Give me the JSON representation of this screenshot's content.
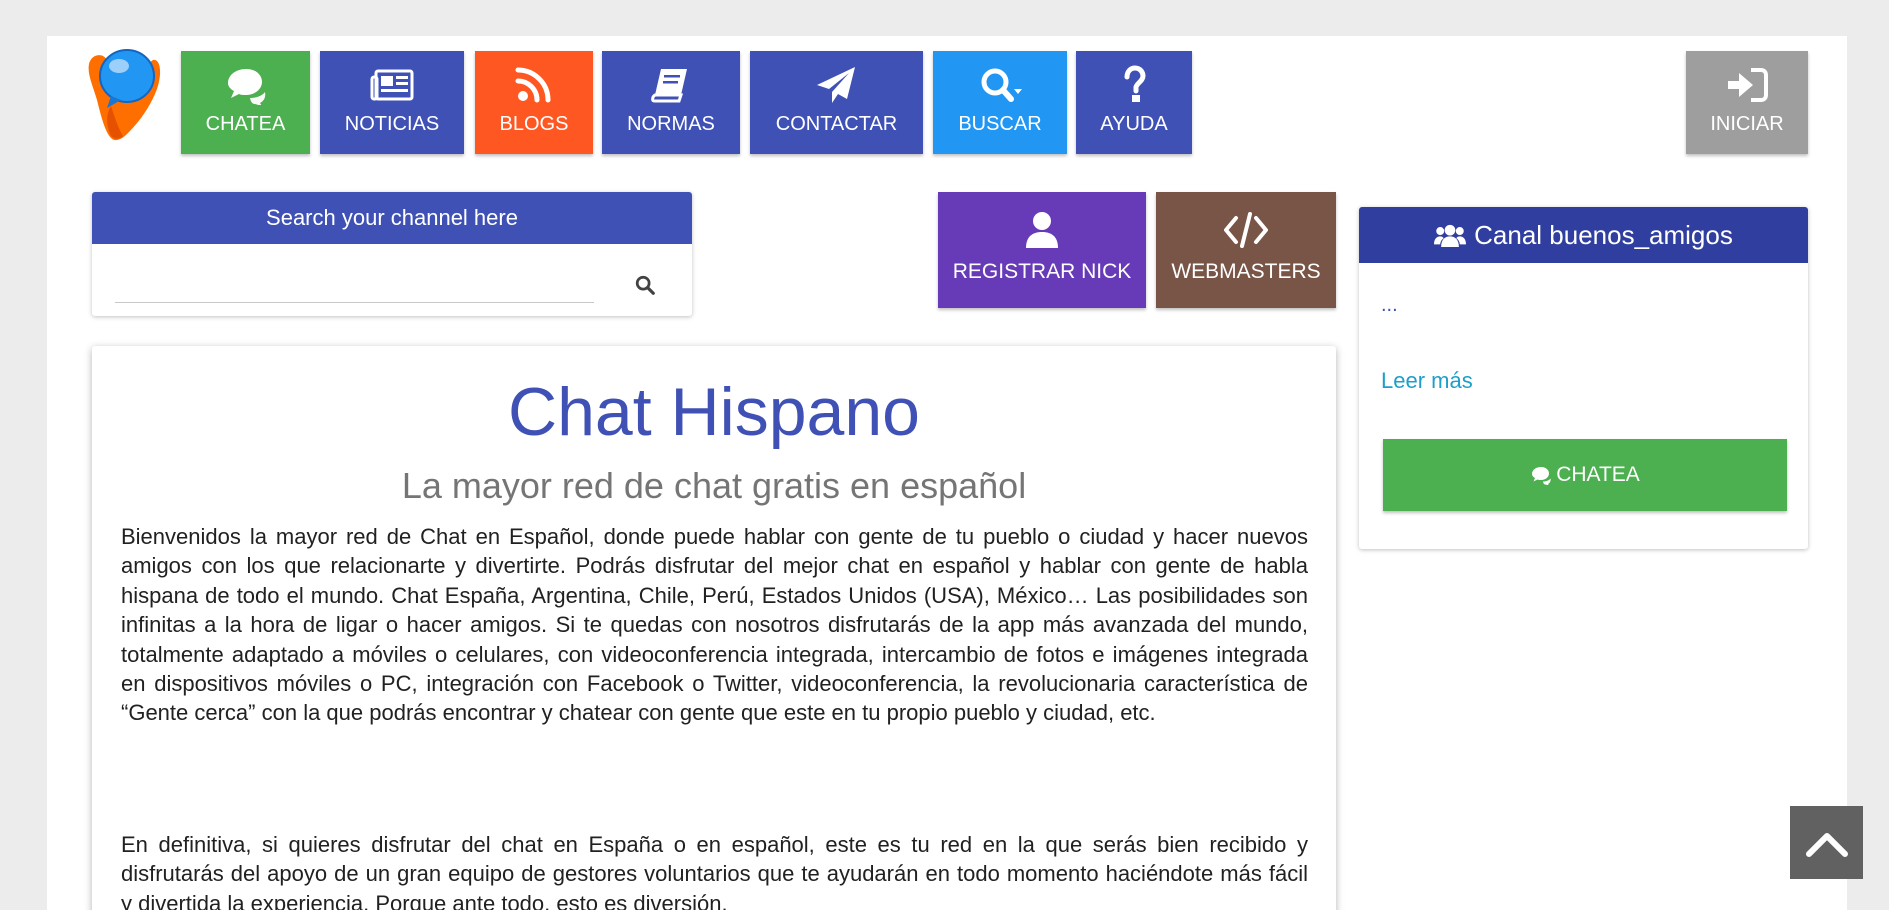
{
  "nav": {
    "items": [
      {
        "label": "CHATEA",
        "icon": "comments-icon",
        "color": "#4caf50"
      },
      {
        "label": "NOTICIAS",
        "icon": "newspaper-icon",
        "color": "#3f51b5"
      },
      {
        "label": "BLOGS",
        "icon": "rss-icon",
        "color": "#ff5722"
      },
      {
        "label": "NORMAS",
        "icon": "book-icon",
        "color": "#3f51b5"
      },
      {
        "label": "CONTACTAR",
        "icon": "paper-plane-icon",
        "color": "#3f51b5"
      },
      {
        "label": "BUSCAR",
        "icon": "search-icon",
        "color": "#2196f3"
      },
      {
        "label": "AYUDA",
        "icon": "question-icon",
        "color": "#3f51b5"
      }
    ],
    "login": {
      "label": "INICIAR",
      "icon": "sign-in-icon",
      "color": "#9e9e9e"
    }
  },
  "search": {
    "header": "Search your channel here",
    "value": "",
    "placeholder": ""
  },
  "actions": [
    {
      "label": "REGISTRAR NICK",
      "icon": "user-icon",
      "color": "#673ab7"
    },
    {
      "label": "WEBMASTERS",
      "icon": "code-icon",
      "color": "#795548"
    }
  ],
  "main": {
    "title": "Chat Hispano",
    "subtitle": "La mayor red de chat gratis en español",
    "paragraphs": [
      "Bienvenidos la mayor red de Chat en Español, donde puede hablar con gente de tu pueblo o ciudad y hacer nuevos amigos con los que relacionarte y divertirte. Podrás disfrutar del mejor chat en español y hablar con gente de habla hispana de todo el mundo. Chat España, Argentina, Chile, Perú, Estados Unidos (USA), México… Las posibilidades son infinitas a la hora de ligar o hacer amigos. Si te quedas con nosotros disfrutarás de la app más avanzada del mundo, totalmente adaptado a móviles o celulares, con videoconferencia integrada, intercambio de fotos e imágenes integrada en dispositivos móviles o PC, integración con Facebook o Twitter, videoconferencia, la revolucionaria característica de “Gente cerca” con la que podrás encontrar y chatear con gente que este en tu propio pueblo y ciudad, etc.",
      "En definitiva, si quieres disfrutar del chat en España o en español, este es tu red en la que serás bien recibido y disfrutarás del apoyo de un gran equipo de gestores voluntarios que te ayudarán en todo momento haciéndote más fácil y divertida la experiencia. Porque ante todo, esto es diversión."
    ]
  },
  "channel": {
    "title": "Canal buenos_amigos",
    "icon": "users-icon",
    "description": "...",
    "read_more": "Leer más",
    "button_label": "CHATEA",
    "button_icon": "comments-icon",
    "button_color": "#4caf50",
    "header_color": "#303f9f"
  },
  "scroll_top": {
    "icon": "chevron-up-icon",
    "color": "#616161"
  }
}
